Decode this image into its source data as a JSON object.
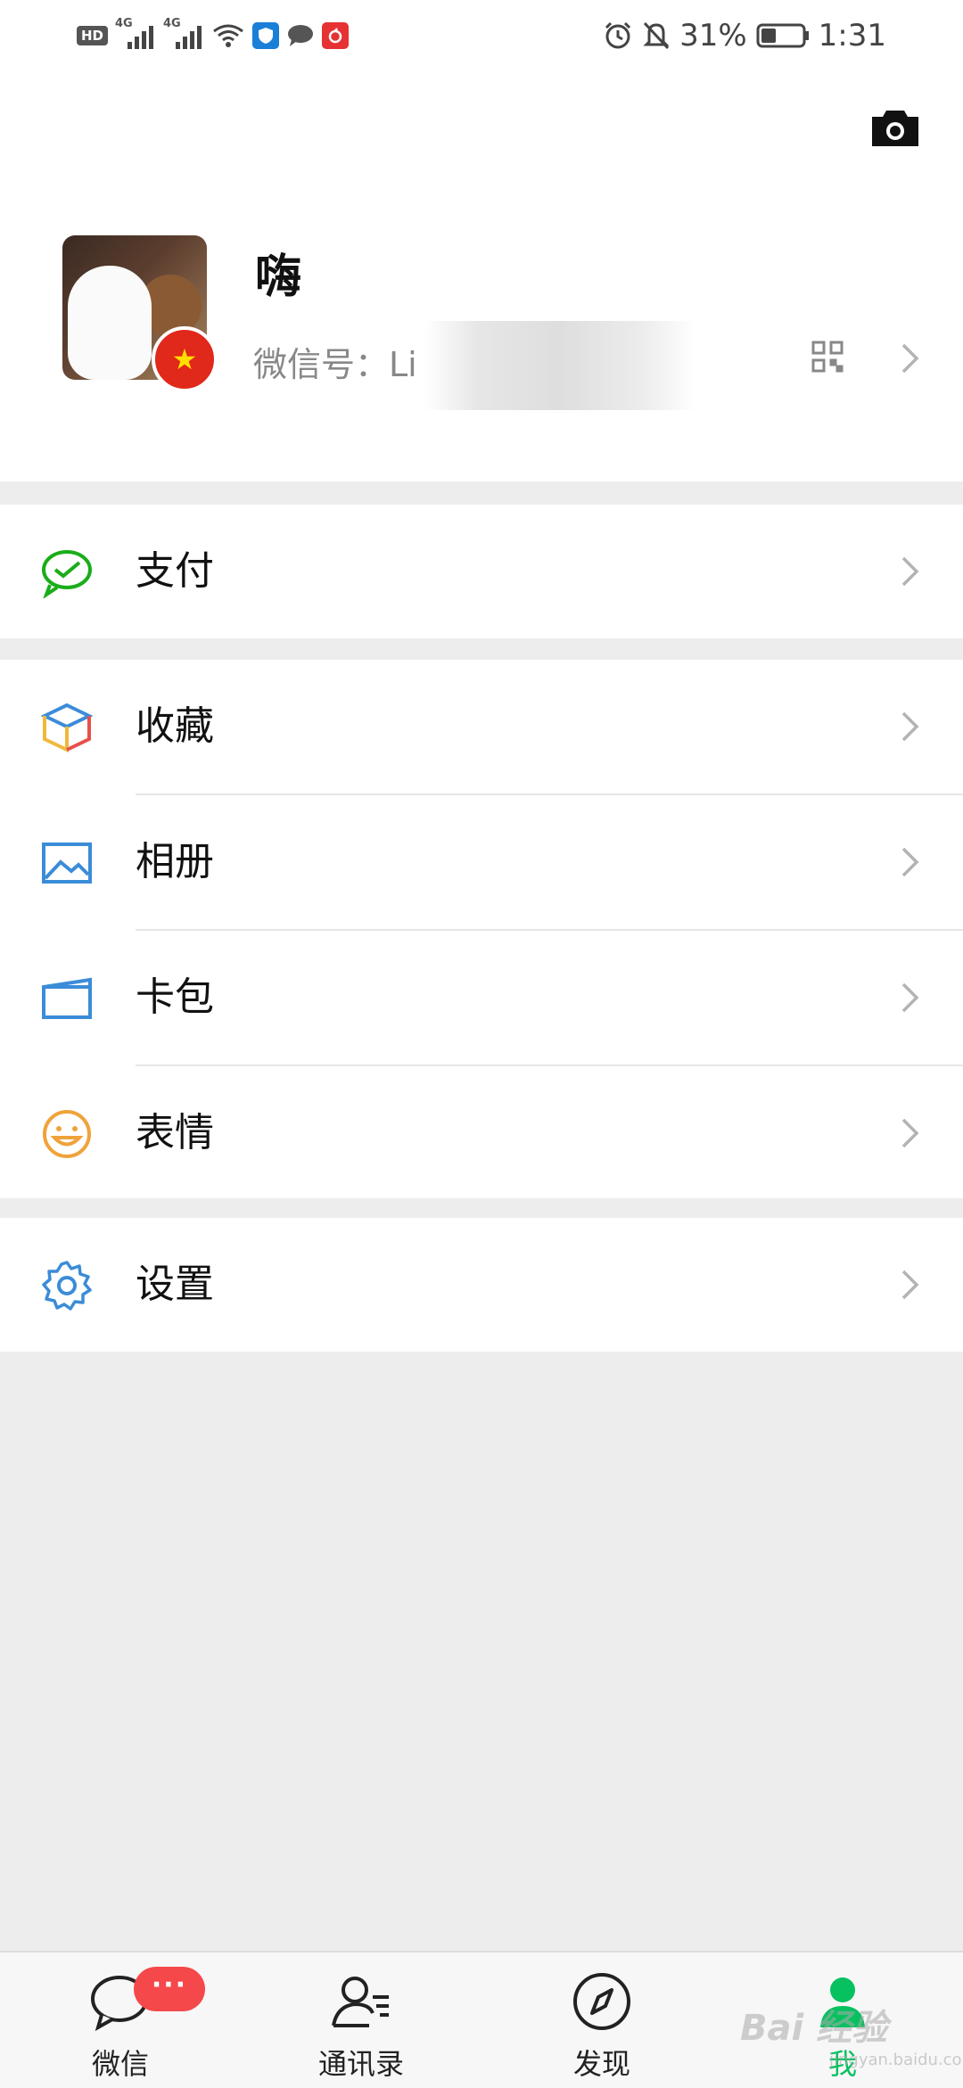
{
  "status_bar": {
    "hd_label": "HD",
    "sim1_label": "4G",
    "sim2_label": "4G",
    "battery_percent": "31%",
    "time": "1:31"
  },
  "profile": {
    "name": "嗨",
    "wechat_id_prefix": "微信号：",
    "wechat_id_visible": "Li"
  },
  "menu": {
    "pay": "支付",
    "favorites": "收藏",
    "album": "相册",
    "cards": "卡包",
    "stickers": "表情",
    "settings": "设置"
  },
  "tabbar": {
    "chats": "微信",
    "contacts": "通讯录",
    "discover": "发现",
    "me": "我",
    "chats_badge": "···"
  },
  "colors": {
    "wechat_green": "#07c160",
    "pay_green": "#1aad19",
    "favorites_blue": "#3b8cd8",
    "album_blue": "#3b8cd8",
    "stickers_orange": "#f0a33a",
    "settings_blue": "#3b8cd8",
    "badge_red": "#f5484a",
    "chevron_gray": "#b3b3b3"
  },
  "watermark": {
    "text": "Bai 经验",
    "url": "jingyan.baidu.com"
  }
}
